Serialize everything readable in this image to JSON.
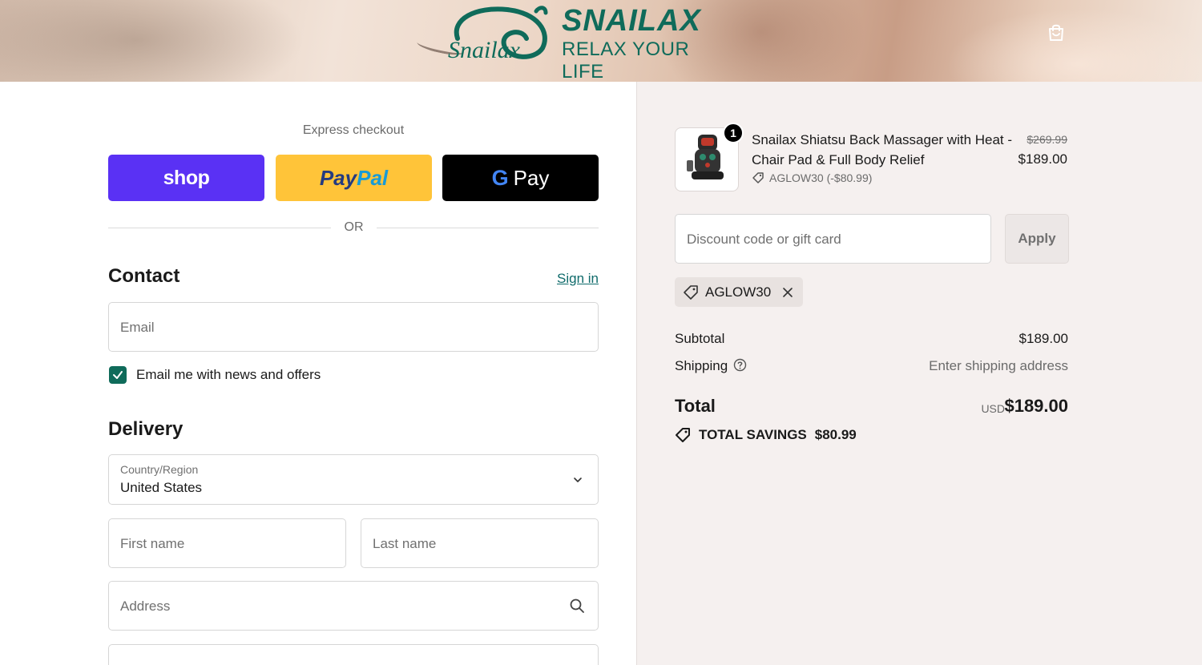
{
  "header": {
    "brand": "SNAILAX",
    "tagline": "RELAX YOUR LIFE",
    "logo_script": "Snailax",
    "cart_icon": "shopping-bag-icon"
  },
  "express": {
    "label": "Express checkout",
    "shop_label": "shop",
    "paypal_part1": "Pay",
    "paypal_part2": "Pal",
    "gpay_g": "G",
    "gpay_label": "Pay",
    "or_label": "OR"
  },
  "contact": {
    "title": "Contact",
    "signin_label": "Sign in",
    "email_placeholder": "Email",
    "newsletter_label": "Email me with news and offers",
    "newsletter_checked": true
  },
  "delivery": {
    "title": "Delivery",
    "country_label": "Country/Region",
    "country_value": "United States",
    "first_name_placeholder": "First name",
    "last_name_placeholder": "Last name",
    "address_placeholder": "Address"
  },
  "summary": {
    "item": {
      "quantity": "1",
      "name": "Snailax Shiatsu Back Massager with Heat - Chair Pad & Full Body Relief",
      "discount": "AGLOW30 (-$80.99)",
      "original_price": "$269.99",
      "price": "$189.00"
    },
    "discount_placeholder": "Discount code or gift card",
    "apply_label": "Apply",
    "applied_code": "AGLOW30",
    "subtotal_label": "Subtotal",
    "subtotal_value": "$189.00",
    "shipping_label": "Shipping",
    "shipping_value": "Enter shipping address",
    "total_label": "Total",
    "total_currency": "USD",
    "total_value": "$189.00",
    "savings_label": "TOTAL SAVINGS",
    "savings_value": "$80.99"
  },
  "colors": {
    "accent": "#0f6b5a",
    "shop_pay": "#5a31f4",
    "paypal": "#ffc439",
    "gpay": "#000000",
    "summary_bg": "#f5f0ef"
  }
}
